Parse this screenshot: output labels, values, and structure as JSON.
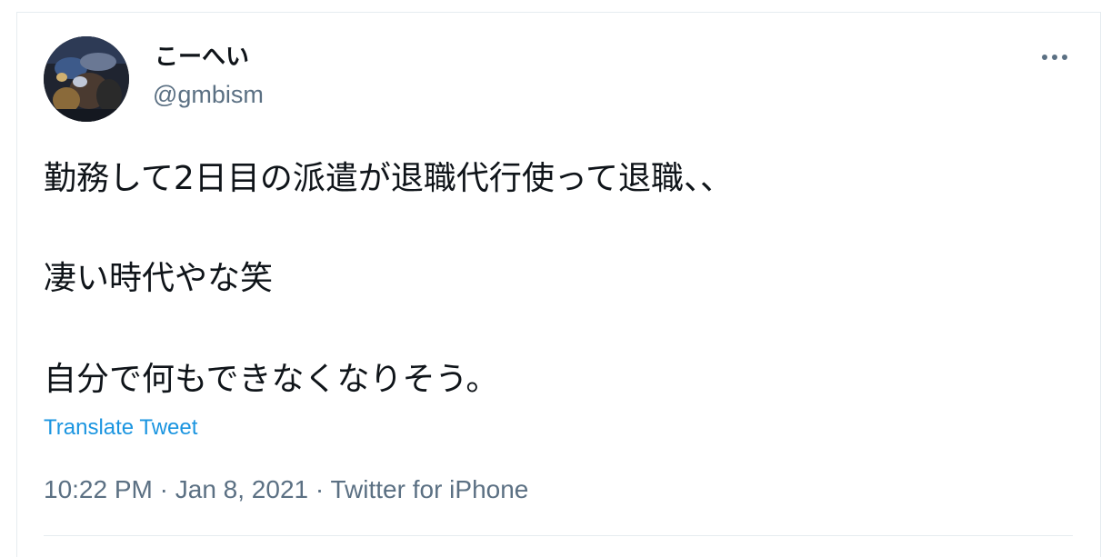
{
  "tweet": {
    "author_name": "こーへい",
    "author_handle": "@gmbism",
    "text_line_1": "勤務して2日目の派遣が退職代行使って退職、、",
    "text_line_2": "凄い時代やな笑",
    "text_line_3": "自分で何もできなくなりそう。",
    "translate_label": "Translate Tweet",
    "time": "10:22 PM",
    "date": "Jan 8, 2021",
    "source": "Twitter for iPhone",
    "separator": " · "
  },
  "icons": {
    "more": "more-options-icon",
    "avatar": "avatar"
  },
  "colors": {
    "text_primary": "#0f1419",
    "text_secondary": "#5b7083",
    "link": "#1b95e0",
    "border": "#e6ecf0"
  }
}
